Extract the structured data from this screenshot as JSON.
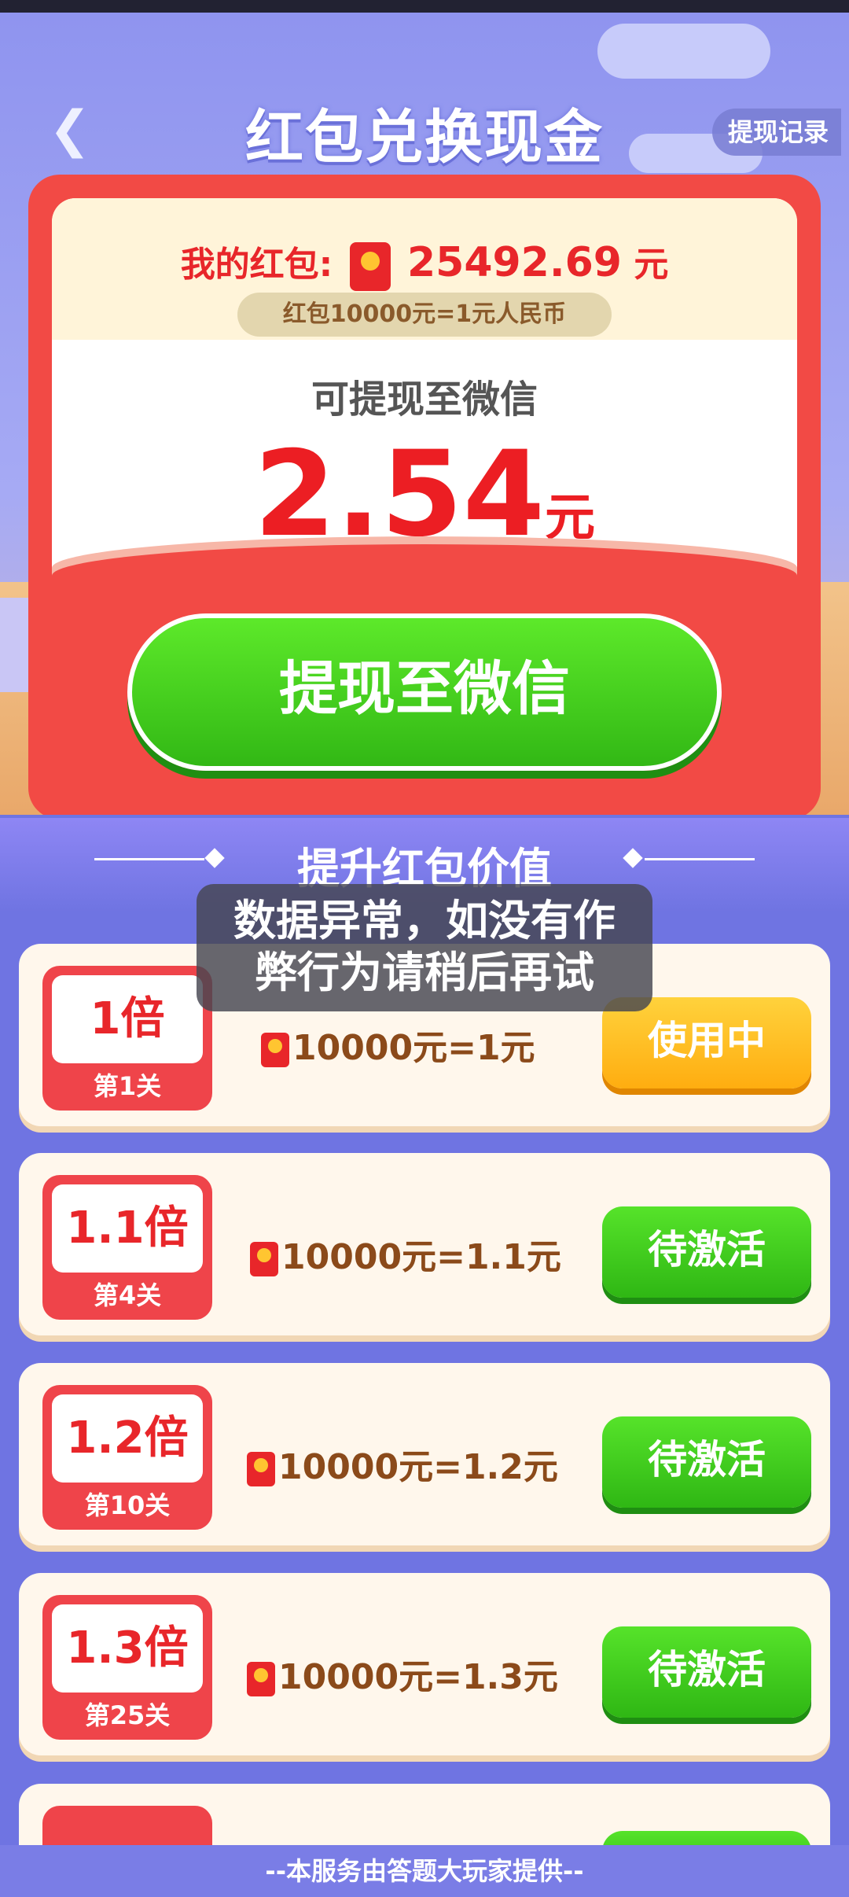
{
  "header": {
    "back_icon": "chevron-left-icon",
    "title": "红包兑换现金",
    "record_label": "提现记录"
  },
  "card": {
    "my_label": "我的红包:",
    "my_amount": "25492.69",
    "my_unit": "元",
    "rate_text": "红包10000元=1元人民币",
    "withdrawable_label": "可提现至微信",
    "withdraw_amount": "2.54",
    "withdraw_unit": "元",
    "withdraw_button": "提现至微信"
  },
  "section": {
    "title": "提升红包价值"
  },
  "levels": [
    {
      "multiplier": "1倍",
      "stage": "第1关",
      "exchange": "10000元=1元",
      "status": "使用中",
      "state": "using"
    },
    {
      "multiplier": "1.1倍",
      "stage": "第4关",
      "exchange": "10000元=1.1元",
      "status": "待激活",
      "state": "pending"
    },
    {
      "multiplier": "1.2倍",
      "stage": "第10关",
      "exchange": "10000元=1.2元",
      "status": "待激活",
      "state": "pending"
    },
    {
      "multiplier": "1.3倍",
      "stage": "第25关",
      "exchange": "10000元=1.3元",
      "status": "待激活",
      "state": "pending"
    }
  ],
  "toast": {
    "line1": "数据异常，如没有作",
    "line2": "弊行为请稍后再试"
  },
  "footer": {
    "text": "--本服务由答题大玩家提供--"
  },
  "colors": {
    "accent_red": "#E8262A",
    "green": "#3BC91C",
    "orange": "#FFB21A",
    "purple": "#6F74E2"
  }
}
